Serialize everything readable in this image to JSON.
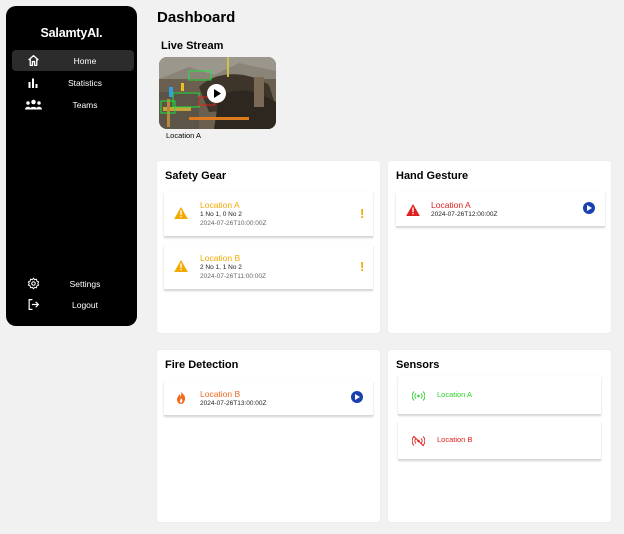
{
  "brand": "SalamtyAI.",
  "nav": {
    "home": "Home",
    "statistics": "Statistics",
    "teams": "Teams",
    "settings": "Settings",
    "logout": "Logout"
  },
  "page_title": "Dashboard",
  "live_stream": {
    "title": "Live Stream",
    "caption": "Location A"
  },
  "safety_gear": {
    "title": "Safety Gear",
    "items": [
      {
        "location": "Location A",
        "detail": "1 No 1, 0 No 2",
        "time": "2024-07-26T10:00:00Z"
      },
      {
        "location": "Location B",
        "detail": "2 No 1, 1 No 2",
        "time": "2024-07-26T11:00:00Z"
      }
    ]
  },
  "hand_gesture": {
    "title": "Hand Gesture",
    "items": [
      {
        "location": "Location A",
        "time": "2024-07-26T12:00:00Z"
      }
    ]
  },
  "fire_detection": {
    "title": "Fire Detection",
    "items": [
      {
        "location": "Location B",
        "time": "2024-07-26T13:00:00Z"
      }
    ]
  },
  "sensors": {
    "title": "Sensors",
    "items": [
      {
        "location": "Location A",
        "status": "online"
      },
      {
        "location": "Location B",
        "status": "offline"
      }
    ]
  },
  "colors": {
    "warning": "#f2a900",
    "danger": "#e02020",
    "fire": "#f26a1b",
    "online": "#2bd52b",
    "offline": "#e02020",
    "play": "#1a3fb0"
  }
}
